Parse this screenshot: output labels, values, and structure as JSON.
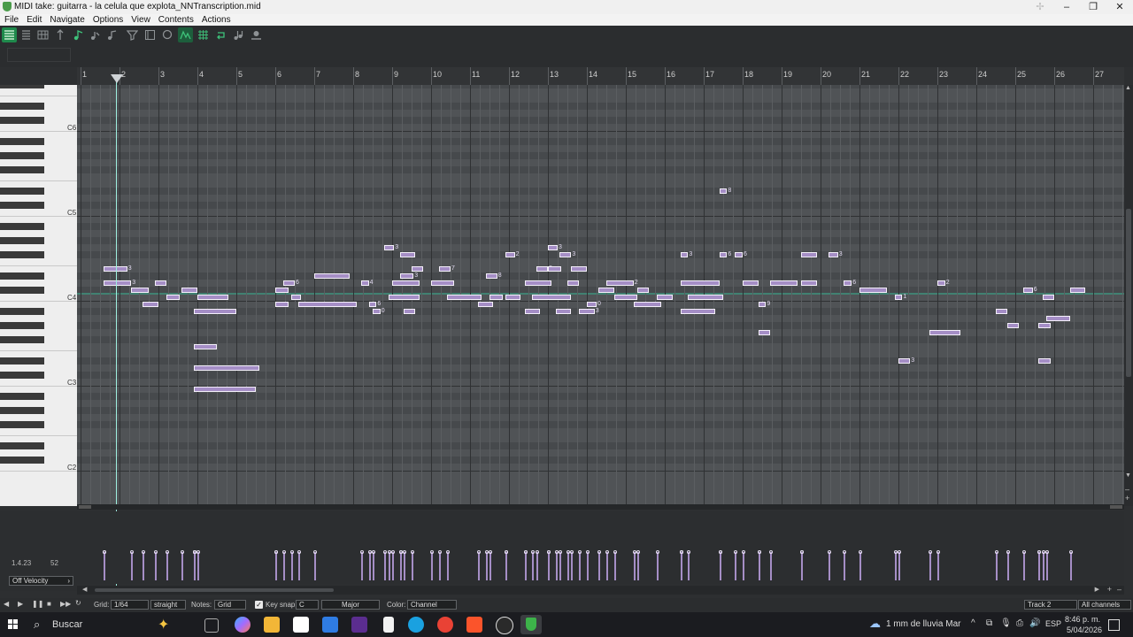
{
  "window": {
    "title": "MIDI take: guitarra - la celula que explota_NNTranscription.mid"
  },
  "menu": [
    "File",
    "Edit",
    "Navigate",
    "Options",
    "View",
    "Contents",
    "Actions"
  ],
  "toolbar_icons": [
    "view-list-icon",
    "menu-lines-icon",
    "grid-view-icon",
    "piano-view-icon",
    "music-note-icon",
    "note-arrow-icon",
    "note-step-icon",
    "filter-icon",
    "frame-icon",
    "search-icon",
    "waveform-icon",
    "grid-toggle-icon",
    "loop-icon",
    "chord-icon",
    "velocity-icon"
  ],
  "ruler": {
    "bars": [
      "1",
      "2",
      "3",
      "4",
      "5",
      "6",
      "7",
      "8",
      "9",
      "10",
      "11",
      "12",
      "13",
      "14",
      "15",
      "16",
      "17",
      "18",
      "19",
      "20",
      "21",
      "22",
      "23",
      "24",
      "25",
      "26",
      "27"
    ]
  },
  "keyboard": {
    "octave_labels": [
      "C6",
      "C5",
      "C4",
      "C3",
      "C2"
    ]
  },
  "notes": [
    {
      "bar": 1.6,
      "len": 0.6,
      "pitch": 64,
      "lab": "3"
    },
    {
      "bar": 1.6,
      "len": 0.7,
      "pitch": 62,
      "lab": "3"
    },
    {
      "bar": 2.3,
      "len": 0.45,
      "pitch": 61,
      "lab": ""
    },
    {
      "bar": 2.6,
      "len": 0.4,
      "pitch": 59,
      "lab": ""
    },
    {
      "bar": 2.9,
      "len": 0.3,
      "pitch": 62,
      "lab": ""
    },
    {
      "bar": 3.2,
      "len": 0.35,
      "pitch": 60,
      "lab": ""
    },
    {
      "bar": 3.6,
      "len": 0.4,
      "pitch": 61,
      "lab": ""
    },
    {
      "bar": 4.0,
      "len": 0.8,
      "pitch": 60,
      "lab": ""
    },
    {
      "bar": 3.9,
      "len": 1.1,
      "pitch": 58,
      "lab": ""
    },
    {
      "bar": 3.9,
      "len": 0.6,
      "pitch": 53,
      "lab": ""
    },
    {
      "bar": 3.9,
      "len": 1.7,
      "pitch": 50,
      "lab": ""
    },
    {
      "bar": 3.9,
      "len": 1.6,
      "pitch": 47,
      "lab": ""
    },
    {
      "bar": 6.0,
      "len": 0.35,
      "pitch": 59,
      "lab": ""
    },
    {
      "bar": 6.0,
      "len": 0.35,
      "pitch": 61,
      "lab": ""
    },
    {
      "bar": 6.2,
      "len": 0.3,
      "pitch": 62,
      "lab": "6"
    },
    {
      "bar": 6.4,
      "len": 0.25,
      "pitch": 60,
      "lab": ""
    },
    {
      "bar": 6.6,
      "len": 1.5,
      "pitch": 59,
      "lab": ""
    },
    {
      "bar": 7.0,
      "len": 0.9,
      "pitch": 63,
      "lab": ""
    },
    {
      "bar": 8.2,
      "len": 0.2,
      "pitch": 62,
      "lab": "4"
    },
    {
      "bar": 8.4,
      "len": 0.2,
      "pitch": 59,
      "lab": "6"
    },
    {
      "bar": 8.5,
      "len": 0.2,
      "pitch": 58,
      "lab": "0"
    },
    {
      "bar": 8.8,
      "len": 0.25,
      "pitch": 67,
      "lab": "3"
    },
    {
      "bar": 8.9,
      "len": 0.8,
      "pitch": 60,
      "lab": ""
    },
    {
      "bar": 9.0,
      "len": 0.7,
      "pitch": 62,
      "lab": ""
    },
    {
      "bar": 9.2,
      "len": 0.35,
      "pitch": 63,
      "lab": "3"
    },
    {
      "bar": 9.2,
      "len": 0.4,
      "pitch": 66,
      "lab": ""
    },
    {
      "bar": 9.3,
      "len": 0.3,
      "pitch": 58,
      "lab": ""
    },
    {
      "bar": 9.5,
      "len": 0.3,
      "pitch": 64,
      "lab": ""
    },
    {
      "bar": 10.0,
      "len": 0.6,
      "pitch": 62,
      "lab": ""
    },
    {
      "bar": 10.2,
      "len": 0.3,
      "pitch": 64,
      "lab": "7"
    },
    {
      "bar": 10.4,
      "len": 0.9,
      "pitch": 60,
      "lab": ""
    },
    {
      "bar": 11.2,
      "len": 0.4,
      "pitch": 59,
      "lab": ""
    },
    {
      "bar": 11.4,
      "len": 0.3,
      "pitch": 63,
      "lab": "8"
    },
    {
      "bar": 11.5,
      "len": 0.35,
      "pitch": 60,
      "lab": ""
    },
    {
      "bar": 11.9,
      "len": 0.25,
      "pitch": 66,
      "lab": "2"
    },
    {
      "bar": 11.9,
      "len": 0.4,
      "pitch": 60,
      "lab": ""
    },
    {
      "bar": 12.4,
      "len": 0.7,
      "pitch": 62,
      "lab": ""
    },
    {
      "bar": 12.4,
      "len": 0.4,
      "pitch": 58,
      "lab": ""
    },
    {
      "bar": 12.6,
      "len": 1.0,
      "pitch": 60,
      "lab": ""
    },
    {
      "bar": 12.7,
      "len": 0.3,
      "pitch": 64,
      "lab": "8"
    },
    {
      "bar": 13.0,
      "len": 0.25,
      "pitch": 67,
      "lab": "3"
    },
    {
      "bar": 13.0,
      "len": 0.35,
      "pitch": 64,
      "lab": ""
    },
    {
      "bar": 13.2,
      "len": 0.4,
      "pitch": 58,
      "lab": ""
    },
    {
      "bar": 13.3,
      "len": 0.3,
      "pitch": 66,
      "lab": "3"
    },
    {
      "bar": 13.5,
      "len": 0.3,
      "pitch": 62,
      "lab": ""
    },
    {
      "bar": 13.6,
      "len": 0.4,
      "pitch": 64,
      "lab": ""
    },
    {
      "bar": 13.8,
      "len": 0.4,
      "pitch": 58,
      "lab": "3"
    },
    {
      "bar": 14.0,
      "len": 0.25,
      "pitch": 59,
      "lab": "0"
    },
    {
      "bar": 14.3,
      "len": 0.4,
      "pitch": 61,
      "lab": ""
    },
    {
      "bar": 14.5,
      "len": 0.7,
      "pitch": 62,
      "lab": "2"
    },
    {
      "bar": 14.7,
      "len": 0.6,
      "pitch": 60,
      "lab": ""
    },
    {
      "bar": 15.2,
      "len": 0.7,
      "pitch": 59,
      "lab": ""
    },
    {
      "bar": 15.3,
      "len": 0.3,
      "pitch": 61,
      "lab": ""
    },
    {
      "bar": 15.8,
      "len": 0.4,
      "pitch": 60,
      "lab": ""
    },
    {
      "bar": 16.4,
      "len": 0.2,
      "pitch": 66,
      "lab": "3"
    },
    {
      "bar": 16.4,
      "len": 1.0,
      "pitch": 62,
      "lab": ""
    },
    {
      "bar": 16.4,
      "len": 0.9,
      "pitch": 58,
      "lab": ""
    },
    {
      "bar": 16.6,
      "len": 0.9,
      "pitch": 60,
      "lab": ""
    },
    {
      "bar": 17.4,
      "len": 0.2,
      "pitch": 75,
      "lab": "8"
    },
    {
      "bar": 17.4,
      "len": 0.2,
      "pitch": 66,
      "lab": "6"
    },
    {
      "bar": 17.8,
      "len": 0.2,
      "pitch": 66,
      "lab": "6"
    },
    {
      "bar": 18.0,
      "len": 0.4,
      "pitch": 62,
      "lab": ""
    },
    {
      "bar": 18.7,
      "len": 0.7,
      "pitch": 62,
      "lab": ""
    },
    {
      "bar": 18.4,
      "len": 0.2,
      "pitch": 59,
      "lab": "9"
    },
    {
      "bar": 18.4,
      "len": 0.3,
      "pitch": 55,
      "lab": ""
    },
    {
      "bar": 19.5,
      "len": 0.4,
      "pitch": 66,
      "lab": ""
    },
    {
      "bar": 19.5,
      "len": 0.4,
      "pitch": 62,
      "lab": ""
    },
    {
      "bar": 20.2,
      "len": 0.25,
      "pitch": 66,
      "lab": "3"
    },
    {
      "bar": 20.6,
      "len": 0.2,
      "pitch": 62,
      "lab": "6"
    },
    {
      "bar": 21.0,
      "len": 0.7,
      "pitch": 61,
      "lab": ""
    },
    {
      "bar": 21.9,
      "len": 0.2,
      "pitch": 60,
      "lab": "1"
    },
    {
      "bar": 22.0,
      "len": 0.3,
      "pitch": 51,
      "lab": "3"
    },
    {
      "bar": 23.0,
      "len": 0.2,
      "pitch": 62,
      "lab": "2"
    },
    {
      "bar": 22.8,
      "len": 0.8,
      "pitch": 55,
      "lab": ""
    },
    {
      "bar": 24.5,
      "len": 0.3,
      "pitch": 58,
      "lab": ""
    },
    {
      "bar": 24.8,
      "len": 0.3,
      "pitch": 56,
      "lab": ""
    },
    {
      "bar": 25.2,
      "len": 0.25,
      "pitch": 61,
      "lab": "6"
    },
    {
      "bar": 25.7,
      "len": 0.3,
      "pitch": 60,
      "lab": ""
    },
    {
      "bar": 25.6,
      "len": 0.3,
      "pitch": 56,
      "lab": ""
    },
    {
      "bar": 25.8,
      "len": 0.6,
      "pitch": 57,
      "lab": ""
    },
    {
      "bar": 26.4,
      "len": 0.4,
      "pitch": 61,
      "lab": ""
    },
    {
      "bar": 25.6,
      "len": 0.3,
      "pitch": 51,
      "lab": ""
    }
  ],
  "velocity_lane": {
    "position": "1.4.23",
    "value": "52",
    "lane_select": "Off Velocity"
  },
  "bottombar": {
    "grid_label": "Grid:",
    "grid_value": "1/64",
    "swing_value": "straight",
    "notes_label": "Notes:",
    "notes_value": "Grid",
    "keysnap_label": "Key snap:",
    "key_value": "C",
    "scale_value": "Major",
    "color_label": "Color:",
    "color_value": "Channel",
    "track_value": "Track 2",
    "channels_value": "All channels"
  },
  "taskbar": {
    "search_placeholder": "Buscar",
    "weather": "1 mm de lluvia Mar",
    "lang": "ESP",
    "time": "8:46 p. m.",
    "date": "5/04/2026"
  },
  "colors": {
    "note_fill": "#a58ec6",
    "grid_bg": "#505356",
    "cursor": "#9ff0e0"
  }
}
